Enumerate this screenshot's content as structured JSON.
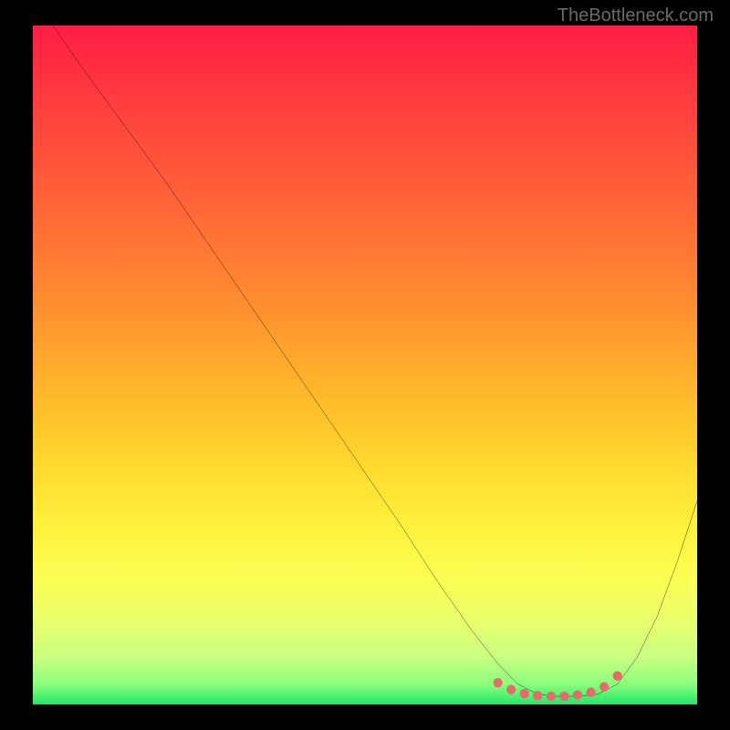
{
  "watermark": "TheBottleneck.com",
  "chart_data": {
    "type": "line",
    "title": "",
    "xlabel": "",
    "ylabel": "",
    "xlim": [
      0,
      100
    ],
    "ylim": [
      0,
      100
    ],
    "grid": false,
    "series": [
      {
        "name": "curve",
        "color": "#000000",
        "x": [
          3,
          8,
          14,
          20,
          27,
          34,
          41,
          48,
          55,
          61,
          66,
          70,
          73,
          76,
          79,
          82,
          85,
          88,
          91,
          94,
          97,
          100
        ],
        "y": [
          100,
          93,
          85,
          77,
          67,
          57,
          47,
          37,
          27,
          18,
          11,
          6,
          3,
          1.5,
          1.2,
          1.2,
          1.5,
          3,
          7,
          13,
          21,
          30
        ]
      }
    ],
    "markers": {
      "color": "#e86b6b",
      "x": [
        70,
        72,
        74,
        76,
        78,
        80,
        82,
        84,
        86,
        88
      ],
      "y": [
        3.2,
        2.2,
        1.6,
        1.3,
        1.2,
        1.2,
        1.4,
        1.8,
        2.6,
        4.2
      ]
    },
    "gradient_stops": [
      {
        "pos": 0.0,
        "color": "#ff1d44"
      },
      {
        "pos": 0.22,
        "color": "#ff5939"
      },
      {
        "pos": 0.45,
        "color": "#ff9a2e"
      },
      {
        "pos": 0.65,
        "color": "#ffda2e"
      },
      {
        "pos": 0.82,
        "color": "#faff55"
      },
      {
        "pos": 0.97,
        "color": "#8bff7c"
      },
      {
        "pos": 1.0,
        "color": "#22e86a"
      }
    ]
  }
}
